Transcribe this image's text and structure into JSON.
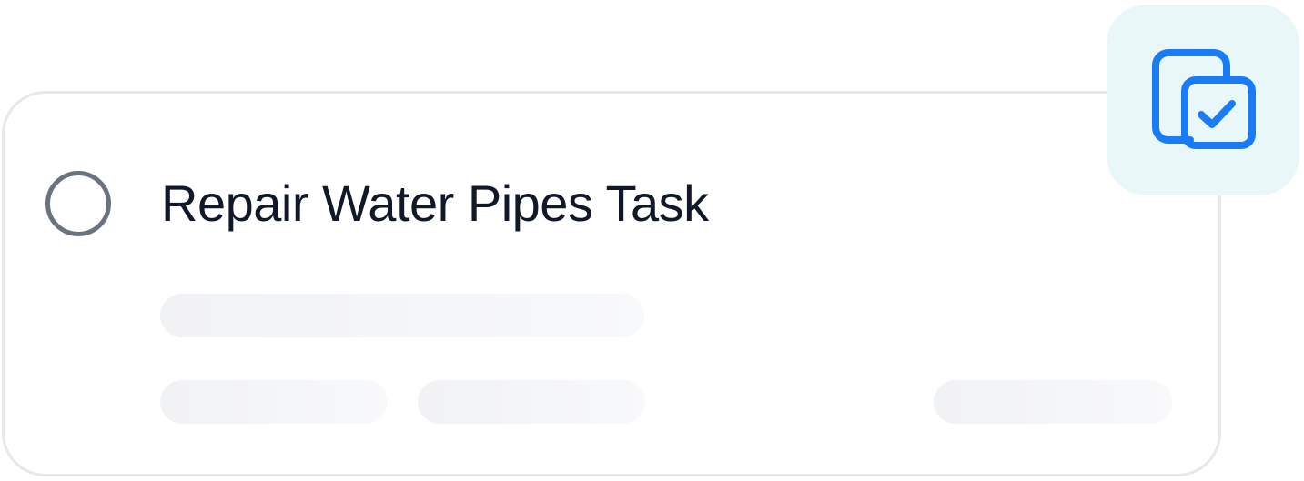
{
  "task": {
    "title": "Repair Water Pipes Task",
    "completed": false
  },
  "icons": {
    "status": "empty-circle-icon",
    "badge": "copy-check-icon"
  },
  "colors": {
    "title_text": "#111827",
    "circle_border": "#6b7280",
    "card_border": "#e6e8eb",
    "skeleton": "#f2f3f5",
    "badge_background": "#e9f7f8",
    "badge_icon": "#1a7cf5"
  }
}
